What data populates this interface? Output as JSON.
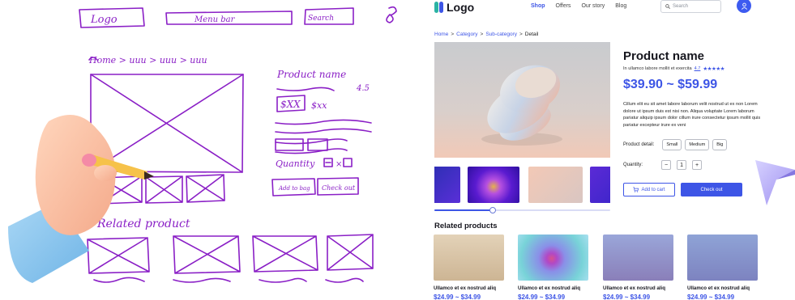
{
  "sketch": {
    "logo": "Logo",
    "menu": "Menu bar",
    "search": "Search",
    "breadcrumb": "Home > uuu > uuu > uuu",
    "product_name": "Product name",
    "rating": "4.5",
    "price": "$XX",
    "price2": "$xx",
    "quantity": "Quantity",
    "add_btn": "Add to bag",
    "checkout_btn": "Check out",
    "related": "Related product"
  },
  "nav": {
    "logo": "Logo",
    "links": [
      "Shop",
      "Offers",
      "Our story",
      "Blog"
    ],
    "search_placeholder": "Search"
  },
  "breadcrumb": [
    "Home",
    "Category",
    "Sub-category",
    "Detail"
  ],
  "product": {
    "title": "Product name",
    "subtitle": "In ullamco labore mollit et exercita",
    "rating": "4.7",
    "stars": "★★★★★",
    "price": "$39.90 ~ $59.99",
    "description": "Cillum elit eu sit amet labore laborum velit nostrud ut ex non Lorem dolore ut ipsum duis est nisi non. Aliqua voluptate Lorem laborum pariatur aliquip ipsum dolor cillum irure consectetur ipsum mollit quis pariatur excepteur irure ex veni",
    "detail_label": "Product detail:",
    "sizes": [
      "Small",
      "Medium",
      "Big"
    ],
    "quantity_label": "Quantity:",
    "quantity": "1",
    "minus": "−",
    "plus": "+",
    "add_to_cart": "Add to cart",
    "checkout": "Check out",
    "gallery_position": 0.33
  },
  "related": {
    "title": "Related products",
    "items": [
      {
        "name": "Ullamco et ex nostrud aliq",
        "price": "$24.99 ~ $34.99"
      },
      {
        "name": "Ullamco et ex nostrud aliq",
        "price": "$24.99 ~ $34.99"
      },
      {
        "name": "Ullamco et ex nostrud aliq",
        "price": "$24.99 ~ $34.99"
      },
      {
        "name": "Ullamco et ex nostrud aliq",
        "price": "$24.99 ~ $34.99"
      }
    ]
  },
  "colors": {
    "accent": "#3d55e6",
    "sketch_ink": "#8a1fc6"
  }
}
